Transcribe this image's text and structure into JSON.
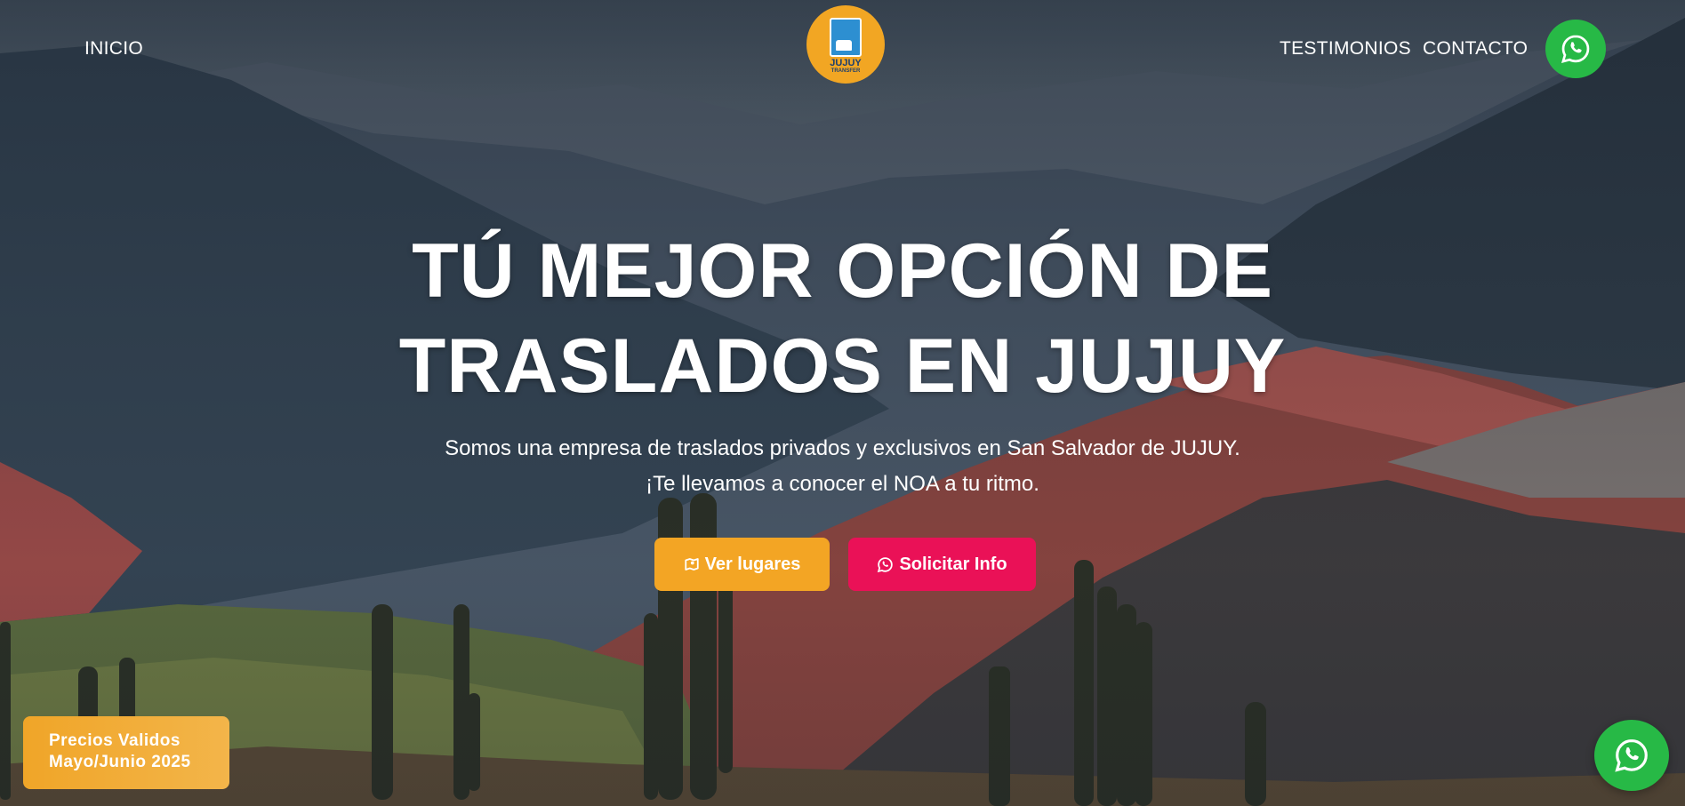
{
  "nav": {
    "inicio": "INICIO",
    "testimonios": "TESTIMONIOS",
    "contacto": "CONTACTO"
  },
  "logo": {
    "line1": "JUJUY",
    "line2": "TRANSFER"
  },
  "hero": {
    "title_line1": "TÚ MEJOR OPCIÓN DE",
    "title_line2": "TRASLADOS EN JUJUY",
    "subtitle_line1": "Somos una empresa de traslados privados y exclusivos en San Salvador de JUJUY.",
    "subtitle_line2": "¡Te llevamos a conocer el NOA a tu ritmo."
  },
  "buttons": {
    "ver_lugares": "Ver lugares",
    "solicitar_info": "Solicitar Info"
  },
  "precios": {
    "line1": "Precios Validos",
    "line2": "Mayo/Junio 2025"
  },
  "icons": {
    "map": "map-icon",
    "whatsapp": "whatsapp-icon"
  },
  "colors": {
    "accent_yellow": "#f3a524",
    "accent_pink": "#ea1157",
    "whatsapp_green": "#27b946"
  }
}
